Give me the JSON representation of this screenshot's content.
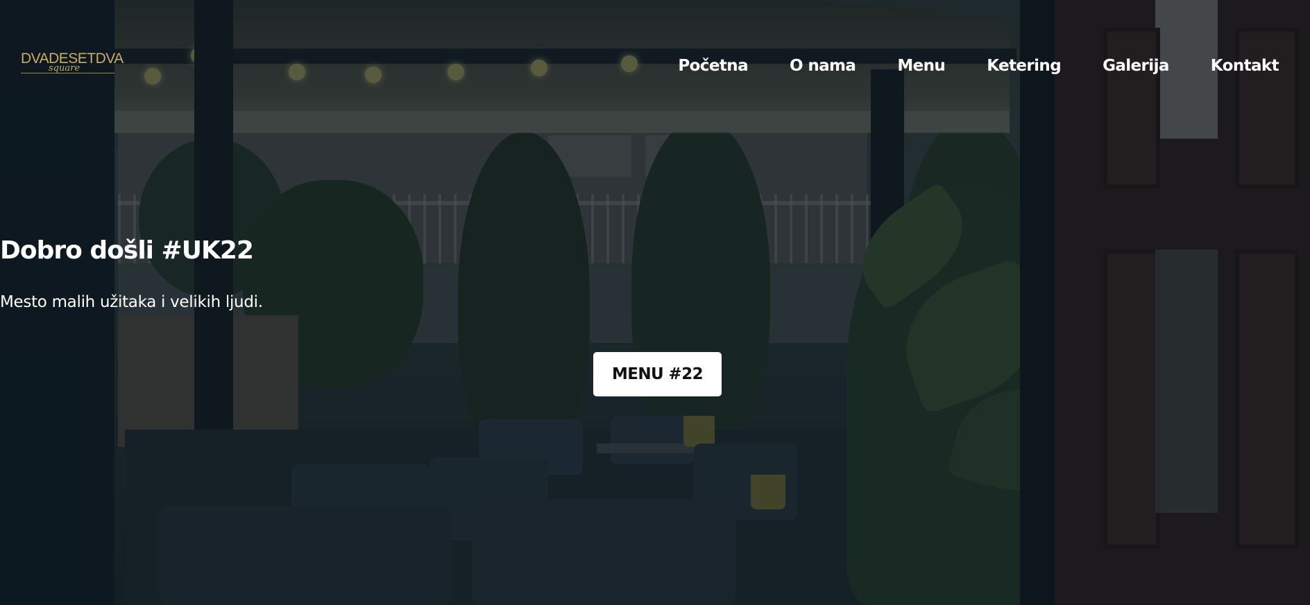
{
  "brand": {
    "logo_main": "DVADESETDVA",
    "logo_script": "square"
  },
  "nav": {
    "items": [
      {
        "label": "Početna"
      },
      {
        "label": "O nama"
      },
      {
        "label": "Menu"
      },
      {
        "label": "Ketering"
      },
      {
        "label": "Galerija"
      },
      {
        "label": "Kontakt"
      }
    ]
  },
  "hero": {
    "title": "Dobro došli #UK22",
    "subtitle": "Mesto malih užitaka i velikih ljudi.",
    "cta_label": "MENU #22"
  },
  "colors": {
    "overlay": "#0d1820",
    "logo_gold": "#c7ad66",
    "text": "#ffffff",
    "button_bg": "#ffffff",
    "button_text": "#111111"
  }
}
